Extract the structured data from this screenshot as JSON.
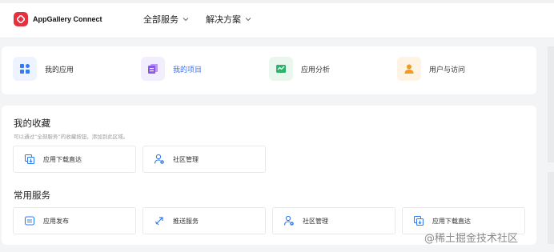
{
  "header": {
    "app_name": "AppGallery Connect",
    "nav": [
      {
        "label": "全部服务"
      },
      {
        "label": "解决方案"
      }
    ]
  },
  "quick_links": [
    {
      "label": "我的应用",
      "icon": "app-grid-icon",
      "color": "#2f7cf6",
      "bg": "#eef4ff",
      "active": false
    },
    {
      "label": "我的项目",
      "icon": "project-icon",
      "color": "#8c57e8",
      "bg": "#f3eefe",
      "active": true
    },
    {
      "label": "应用分析",
      "icon": "analytics-icon",
      "color": "#2db46a",
      "bg": "#eaf7ef",
      "active": false
    },
    {
      "label": "用户与访问",
      "icon": "user-icon",
      "color": "#f39b1c",
      "bg": "#fff4e4",
      "active": false
    }
  ],
  "favorites": {
    "title": "我的收藏",
    "subtitle": "可以通过“全部服务”的收藏按钮，添加到此区域。",
    "items": [
      {
        "label": "应用下载直达",
        "icon": "download-link-icon"
      },
      {
        "label": "社区管理",
        "icon": "community-user-icon"
      }
    ]
  },
  "common_services": {
    "title": "常用服务",
    "items": [
      {
        "label": "应用发布",
        "icon": "publish-icon"
      },
      {
        "label": "推送服务",
        "icon": "push-icon"
      },
      {
        "label": "社区管理",
        "icon": "community-user-icon"
      },
      {
        "label": "应用下载直达",
        "icon": "download-link-icon"
      }
    ]
  },
  "watermark": "@稀土掘金技术社区",
  "colors": {
    "accent_blue": "#3a6ff7",
    "icon_blue": "#2f7cf6",
    "logo_red": "#e5303d"
  }
}
